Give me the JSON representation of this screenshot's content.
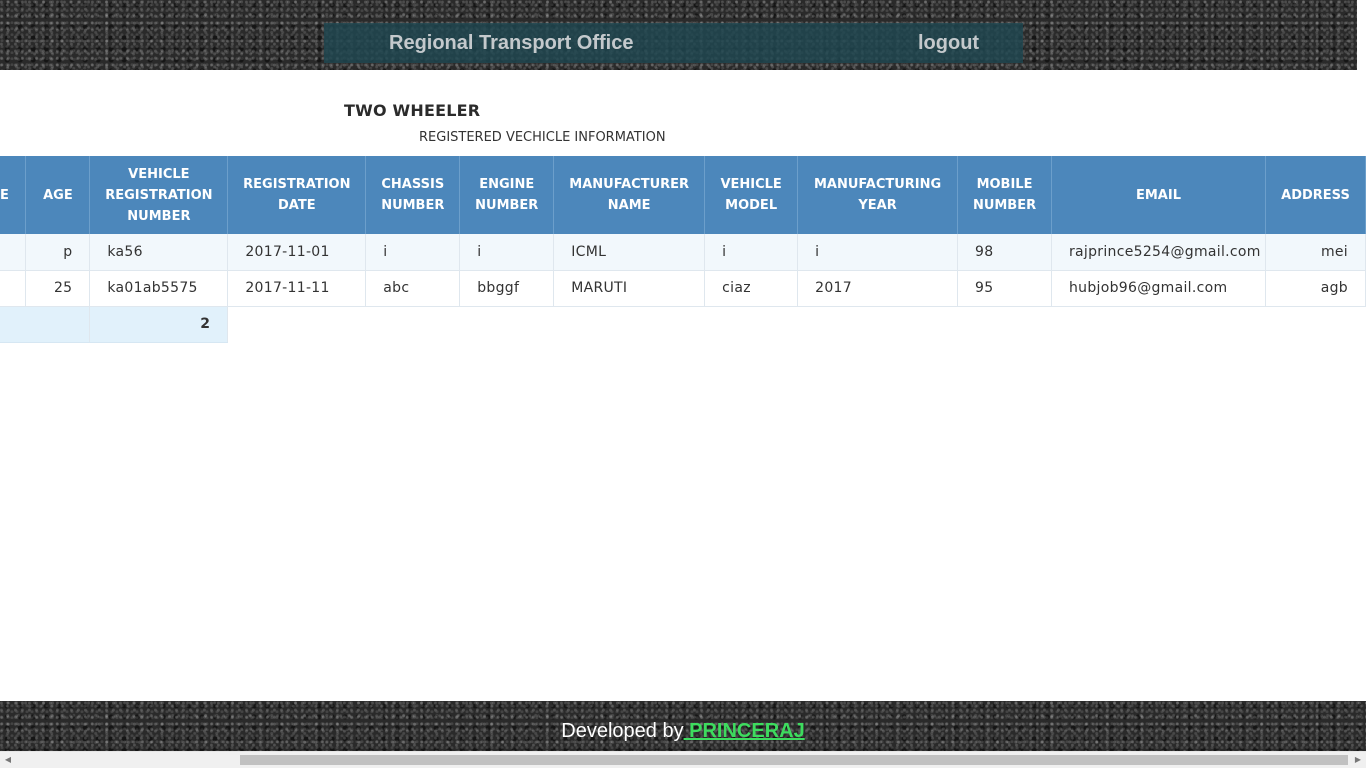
{
  "header": {
    "title": "Regional Transport Office",
    "logout_label": "logout"
  },
  "page": {
    "title": "TWO WHEELER",
    "subtitle": "REGISTERED VECHICLE INFORMATION"
  },
  "table": {
    "columns": [
      "E",
      "AGE",
      "VEHICLE REGISTRATION NUMBER",
      "REGISTRATION DATE",
      "CHASSIS NUMBER",
      "ENGINE NUMBER",
      "MANUFACTURER NAME",
      "VEHICLE MODEL",
      "MANUFACTURING YEAR",
      "MOBILE NUMBER",
      "EMAIL",
      "ADDRESS"
    ],
    "rows": [
      [
        "",
        "p",
        "ka56",
        "2017-11-01",
        "i",
        "i",
        "ICML",
        "i",
        "i",
        "98",
        "rajprince5254@gmail.com",
        "mei"
      ],
      [
        "",
        "25",
        "ka01ab5575",
        "2017-11-11",
        "abc",
        "bbggf",
        "MARUTI",
        "ciaz",
        "2017",
        "95",
        "hubjob96@gmail.com",
        "agb"
      ]
    ],
    "row_count": "2"
  },
  "footer": {
    "credit_text": "Developed by",
    "author": " PRINCERAJ"
  },
  "scrollbar": {
    "left_arrow_icon": "chevron-left-icon",
    "right_arrow_icon": "chevron-right-icon"
  }
}
